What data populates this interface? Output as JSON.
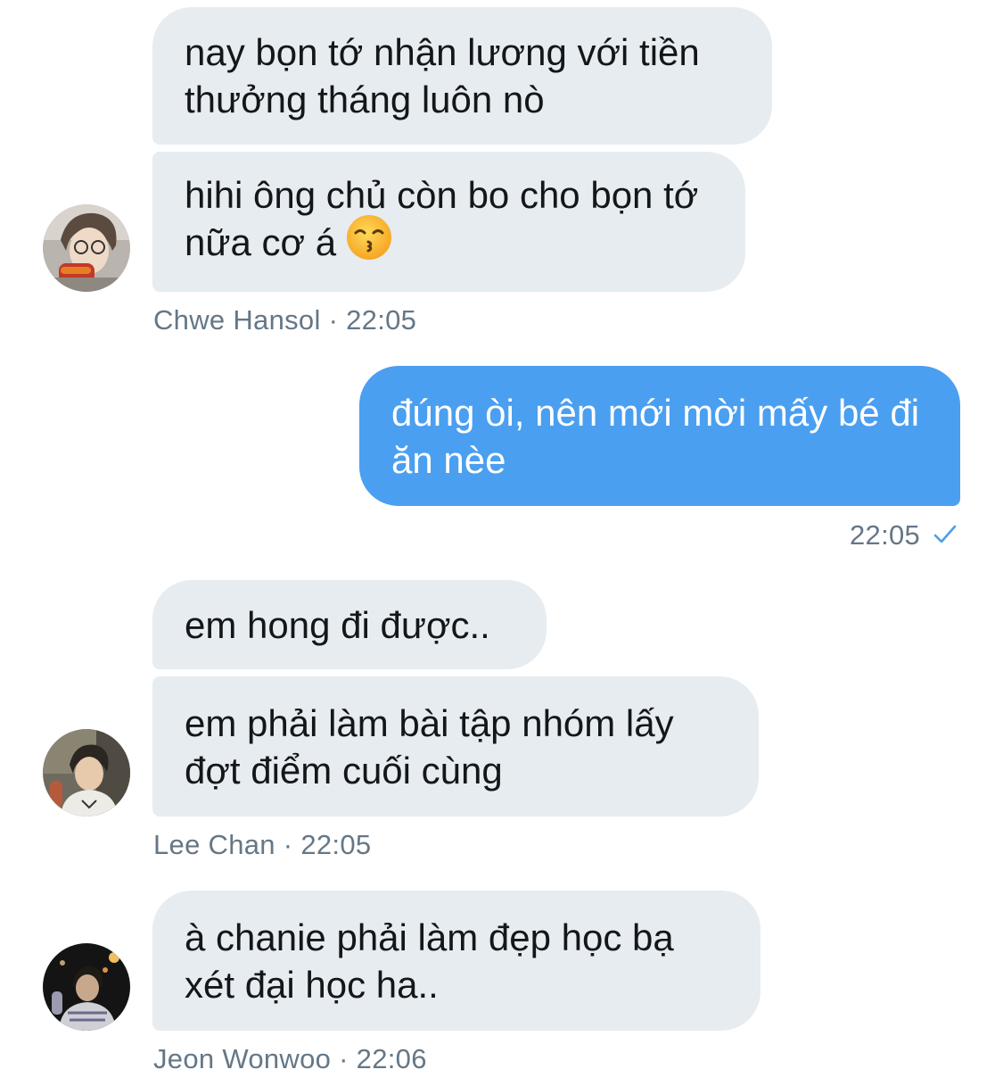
{
  "messages": [
    {
      "sender": "Chwe Hansol",
      "time": "22:05",
      "bubbles": [
        {
          "text": "nay bọn tớ nhận lương với tiền thưởng tháng luôn nò"
        },
        {
          "text": "hihi ông chủ còn bo cho bọn tớ nữa cơ á",
          "emoji": "kissing-face-emoji"
        }
      ]
    },
    {
      "own": true,
      "time": "22:05",
      "status_icon": "checkmark-icon",
      "bubbles": [
        {
          "text": "đúng òi, nên mới mời mấy bé đi ăn nèe"
        }
      ]
    },
    {
      "sender": "Lee Chan",
      "time": "22:05",
      "bubbles": [
        {
          "text": "em hong đi được.."
        },
        {
          "text": "em phải làm bài tập nhóm lấy đợt điểm cuối cùng"
        }
      ]
    },
    {
      "sender": "Jeon Wonwoo",
      "time": "22:06",
      "bubbles": [
        {
          "text": "à chanie phải làm đẹp học bạ xét đại học ha.."
        }
      ]
    }
  ],
  "separator": "·",
  "colors": {
    "incoming_bubble": "#e6ecf0",
    "outgoing_bubble": "#4a9ff0",
    "meta_text": "#657786",
    "message_text": "#14171a"
  }
}
